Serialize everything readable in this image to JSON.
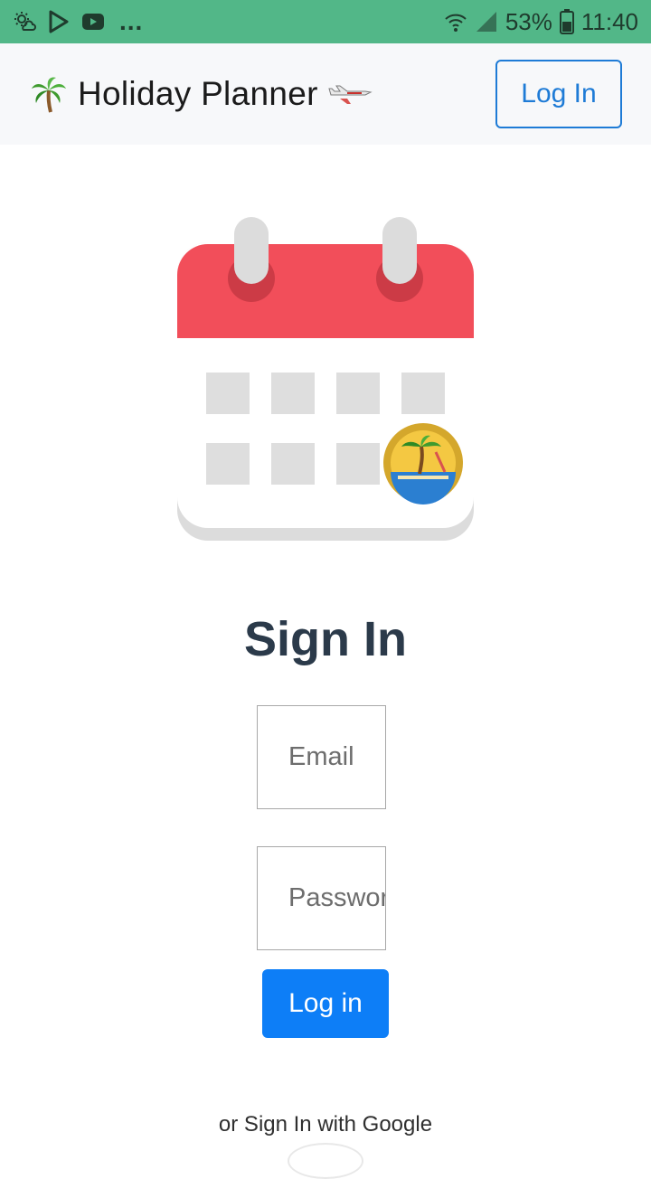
{
  "status_bar": {
    "battery": "53%",
    "time": "11:40",
    "more": "...",
    "icons": [
      "weather-icon",
      "play-store-icon",
      "youtube-icon",
      "wifi-icon",
      "signal-icon",
      "battery-icon"
    ]
  },
  "navbar": {
    "title": "Holiday Planner",
    "login_label": "Log In",
    "icons": [
      "palm-tree-icon",
      "airplane-icon"
    ]
  },
  "colors": {
    "status_bar": "#52b788",
    "navbar_bg": "#f7f8fa",
    "accent": "#1e7bd6",
    "primary_button": "#0d7ef7",
    "calendar_header": "#f24e5a",
    "title": "#2b3a4a"
  },
  "signin": {
    "title": "Sign In",
    "email_placeholder": "Email",
    "password_placeholder": "Password",
    "login_label": "Log in",
    "google_text": "or Sign In with Google"
  }
}
